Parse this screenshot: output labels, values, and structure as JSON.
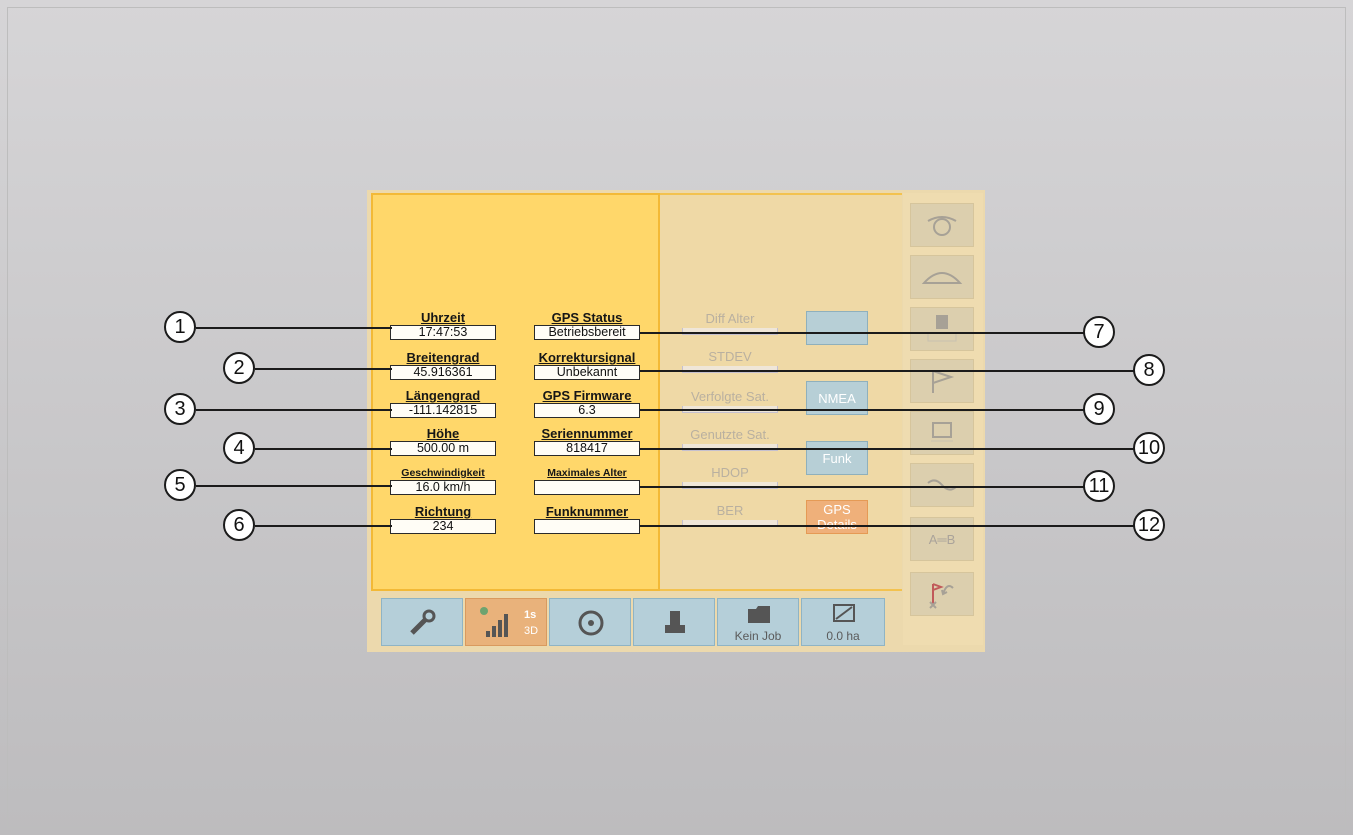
{
  "bottom_bar": {
    "gps_speed": "1s",
    "gps_fix": "3D",
    "job": "Kein Job",
    "area": "0.0 ha"
  },
  "fields_left": {
    "time": {
      "label": "Uhrzeit",
      "value": "17:47:53"
    },
    "latitude": {
      "label": "Breitengrad",
      "value": "45.916361"
    },
    "longitude": {
      "label": "Längengrad",
      "value": "-111.142815"
    },
    "altitude": {
      "label": "Höhe",
      "value": "500.00 m"
    },
    "speed": {
      "label": "Geschwindigkeit",
      "value": "16.0 km/h"
    },
    "heading": {
      "label": "Richtung",
      "value": "234"
    }
  },
  "fields_mid": {
    "gps_status": {
      "label": "GPS Status",
      "value": "Betriebsbereit"
    },
    "correction": {
      "label": "Korrektursignal",
      "value": "Unbekannt"
    },
    "firmware": {
      "label": "GPS Firmware",
      "value": "6.3"
    },
    "serial": {
      "label": "Seriennummer",
      "value": "818417"
    },
    "max_age": {
      "label": "Maximales Alter",
      "value": ""
    },
    "radio_number": {
      "label": "Funknummer",
      "value": ""
    }
  },
  "faded": {
    "diff_age": "Diff Alter",
    "stdev": "STDEV",
    "tracked_sat": "Verfolgte Sat.",
    "used_sat": "Genutzte Sat.",
    "hdop": "HDOP",
    "ber": "BER"
  },
  "right_buttons": {
    "nmea": "NMEA",
    "funk": "Funk",
    "gps_line1": "GPS",
    "gps_line2": "Details"
  },
  "side_buttons": {
    "ab": "A═B"
  },
  "callouts": [
    "1",
    "2",
    "3",
    "4",
    "5",
    "6",
    "7",
    "8",
    "9",
    "10",
    "11",
    "12"
  ]
}
